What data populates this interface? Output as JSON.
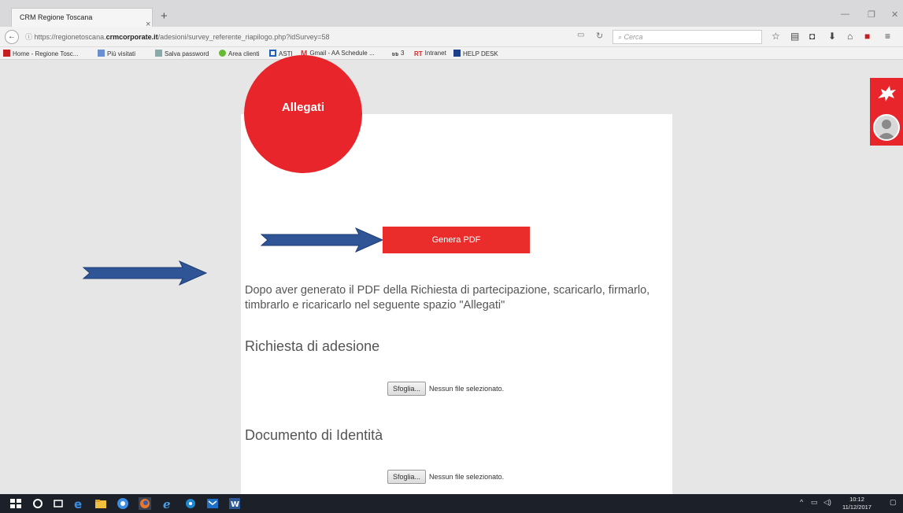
{
  "browser": {
    "tab_title": "CRM Regione Toscana",
    "tab_close": "×",
    "new_tab": "+",
    "url_prefix": "https://regionetoscana.",
    "url_domain": "crmcorporate.it",
    "url_path": "/adesioni/survey_referente_riapilogo.php?idSurvey=58",
    "search_placeholder": "Cerca",
    "bookmarks": [
      "Home - Regione Tosc...",
      "Più visitati",
      "Salva password",
      "Area clienti",
      "ASTI",
      "Gmail - AA Schedule ...",
      "3",
      "Intranet",
      "HELP DESK"
    ]
  },
  "page": {
    "badge_title": "Allegati",
    "generate_button": "Genera PDF",
    "instructions": "Dopo aver generato il PDF della Richiesta di partecipazione, scaricarlo, firmarlo, timbrarlo e ricaricarlo nel seguente spazio \"Allegati\"",
    "sections": [
      {
        "heading": "Richiesta di adesione",
        "browse_label": "Sfoglia...",
        "file_status": "Nessun file selezionato."
      },
      {
        "heading": "Documento di Identità",
        "browse_label": "Sfoglia...",
        "file_status": "Nessun file selezionato."
      }
    ]
  },
  "taskbar": {
    "time": "10:12",
    "date": "11/12/2017"
  },
  "colors": {
    "accent_red": "#e8252a",
    "arrow_blue": "#2f5597"
  }
}
